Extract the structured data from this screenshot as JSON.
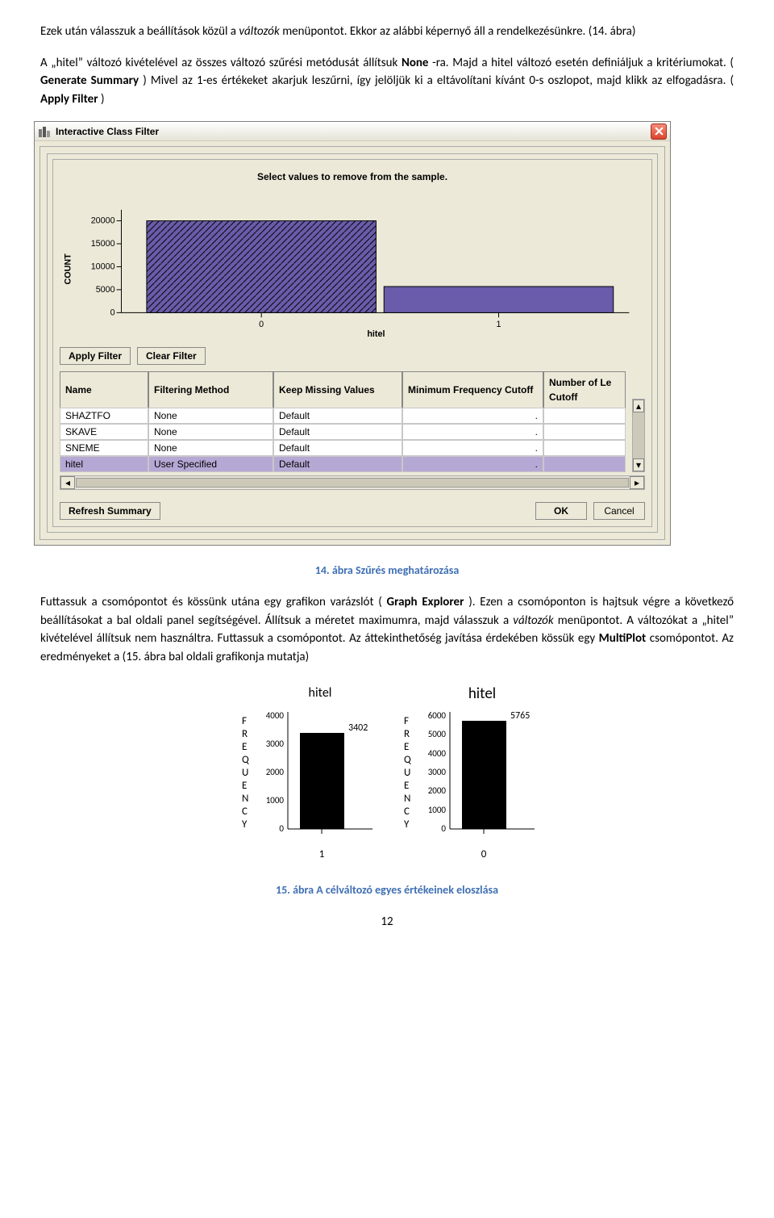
{
  "paragraph1_a": "Ezek után válasszuk a beállítások közül a ",
  "paragraph1_b": "változók",
  "paragraph1_c": " menüpontot. Ekkor az alábbi képernyő áll a rendelkezésünkre. (14. ábra)",
  "paragraph2_a": "A „hitel” változó kivételével az összes változó szűrési metódusát állítsuk ",
  "paragraph2_b": "None",
  "paragraph2_c": "-ra. Majd a hitel változó esetén definiáljuk a kritériumokat. (",
  "paragraph2_d": "Generate Summary",
  "paragraph2_e": ") Mivel az 1-es értékeket akarjuk leszűrni, így jelöljük ki a eltávolítani kívánt 0-s oszlopot, majd klikk az elfogadásra. (",
  "paragraph2_f": "Apply Filter",
  "paragraph2_g": ")",
  "dialog": {
    "title": "Interactive Class Filter",
    "chart_title": "Select values to remove from the sample.",
    "y_label": "COUNT",
    "x_label": "hitel",
    "apply_filter": "Apply Filter",
    "clear_filter": "Clear Filter",
    "headers": {
      "name": "Name",
      "filtering": "Filtering Method",
      "keepmissing": "Keep Missing Values",
      "minfreq": "Minimum Frequency Cutoff",
      "numle": "Number of Le Cutoff"
    },
    "rows": [
      {
        "name": "SHAZTFO",
        "method": "None",
        "kmv": "Default",
        "mfc": ".",
        "nlc": ""
      },
      {
        "name": "SKAVE",
        "method": "None",
        "kmv": "Default",
        "mfc": ".",
        "nlc": ""
      },
      {
        "name": "SNEME",
        "method": "None",
        "kmv": "Default",
        "mfc": ".",
        "nlc": ""
      },
      {
        "name": "hitel",
        "method": "User Specified",
        "kmv": "Default",
        "mfc": ".",
        "nlc": ""
      }
    ],
    "refresh": "Refresh Summary",
    "ok": "OK",
    "cancel": "Cancel"
  },
  "chart_data": {
    "type": "bar",
    "categories": [
      "0",
      "1"
    ],
    "values": [
      20000,
      5700
    ],
    "title": "Select values to remove from the sample.",
    "xlabel": "hitel",
    "ylabel": "COUNT",
    "yticks": [
      0,
      5000,
      10000,
      15000,
      20000
    ],
    "ylim": [
      0,
      20000
    ],
    "selected_index": 0
  },
  "caption14": "14. ábra Szűrés meghatározása",
  "paragraph3_a": "Futtassuk a csomópontot és kössünk utána egy grafikon varázslót (",
  "paragraph3_b": "Graph Explorer",
  "paragraph3_c": "). Ezen a csomóponton is hajtsuk végre a következő beállításokat a bal oldali panel segítségével. Állítsuk a méretet maximumra, majd válasszuk a ",
  "paragraph3_d": "változók",
  "paragraph3_e": " menüpontot. A változókat a „hitel” kivételével állítsuk nem használtra. Futtassuk a csomópontot. Az áttekinthetőség javítása érdekében kössük egy ",
  "paragraph3_f": "MultiPlot",
  "paragraph3_g": " csomópontot. Az eredményeket a (15. ábra bal oldali grafikonja mutatja)",
  "minicharts": {
    "left": {
      "title": "hitel",
      "ylabel": "FREQUENCY",
      "yticks": [
        0,
        1000,
        2000,
        3000,
        4000
      ],
      "category": "1",
      "value": 3402,
      "label": "3402"
    },
    "right": {
      "title": "hitel",
      "ylabel": "FREQUENCY",
      "yticks": [
        0,
        1000,
        2000,
        3000,
        4000,
        5000,
        6000
      ],
      "category": "0",
      "value": 5765,
      "label": "5765"
    }
  },
  "caption15": "15. ábra A célváltozó egyes értékeinek eloszlása",
  "pagenum": "12"
}
